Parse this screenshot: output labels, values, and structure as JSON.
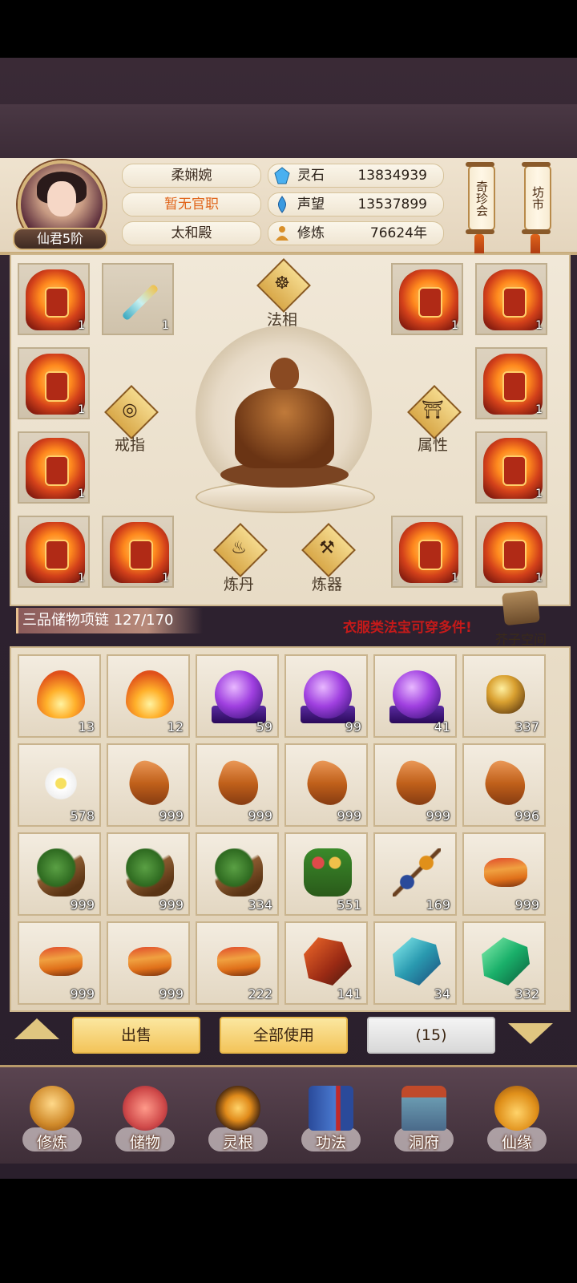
{
  "player": {
    "rank": "仙君5阶",
    "name": "柔娴婉",
    "office": "暂无官职",
    "palace": "太和殿"
  },
  "stats": [
    {
      "icon": "spirit-stone-icon",
      "label": "灵石",
      "value": "13834939"
    },
    {
      "icon": "prestige-icon",
      "label": "声望",
      "value": "13537899"
    },
    {
      "icon": "cultivation-icon",
      "label": "修炼",
      "value": "76624年"
    }
  ],
  "scrolls": {
    "treasure_fair": "奇珍会",
    "market": "坊市"
  },
  "equipment": {
    "slots": [
      {
        "item": "armor",
        "count": "1"
      },
      {
        "item": "sword",
        "count": "1"
      },
      {
        "item": "armor",
        "count": "1"
      },
      {
        "item": "armor",
        "count": "1"
      },
      {
        "item": "armor",
        "count": "1"
      },
      {
        "item": "armor",
        "count": "1"
      },
      {
        "item": "armor",
        "count": "1"
      },
      {
        "item": "armor",
        "count": "1"
      },
      {
        "item": "armor",
        "count": "1"
      },
      {
        "item": "armor",
        "count": "1"
      },
      {
        "item": "armor",
        "count": "1"
      },
      {
        "item": "armor",
        "count": "1"
      }
    ],
    "faxiang": "法相",
    "ring": "戒指",
    "attributes": "属性",
    "alchemy": "炼丹",
    "forging": "炼器"
  },
  "bag": {
    "title": "三品储物项链 127/170",
    "notice": "衣服类法宝可穿多件!",
    "space_label": "芥子空间",
    "items": [
      {
        "type": "flame",
        "count": "13"
      },
      {
        "type": "flame",
        "count": "12"
      },
      {
        "type": "orb",
        "count": "59"
      },
      {
        "type": "orb",
        "count": "99"
      },
      {
        "type": "orb",
        "count": "41"
      },
      {
        "type": "ore",
        "count": "337"
      },
      {
        "type": "flower",
        "count": "578"
      },
      {
        "type": "root",
        "count": "999"
      },
      {
        "type": "root",
        "count": "999"
      },
      {
        "type": "root",
        "count": "999"
      },
      {
        "type": "root",
        "count": "999"
      },
      {
        "type": "root",
        "count": "996"
      },
      {
        "type": "herb",
        "count": "999"
      },
      {
        "type": "herb",
        "count": "999"
      },
      {
        "type": "herb",
        "count": "334"
      },
      {
        "type": "sprig",
        "count": "551"
      },
      {
        "type": "branch",
        "count": "169"
      },
      {
        "type": "worm",
        "count": "999"
      },
      {
        "type": "worm",
        "count": "999"
      },
      {
        "type": "worm",
        "count": "999"
      },
      {
        "type": "worm",
        "count": "222"
      },
      {
        "type": "crystal-red",
        "count": "141"
      },
      {
        "type": "crystal-blue",
        "count": "34"
      },
      {
        "type": "crystal-green",
        "count": "332"
      }
    ]
  },
  "actions": {
    "sell": "出售",
    "use_all": "全部使用",
    "quantity": "(15)"
  },
  "nav": [
    {
      "label": "修炼",
      "icon": "cultivate-icon"
    },
    {
      "label": "储物",
      "icon": "storage-bag-icon"
    },
    {
      "label": "灵根",
      "icon": "spirit-root-icon"
    },
    {
      "label": "功法",
      "icon": "technique-book-icon"
    },
    {
      "label": "洞府",
      "icon": "cave-dwelling-icon"
    },
    {
      "label": "仙缘",
      "icon": "destiny-gourd-icon"
    }
  ],
  "colors": {
    "accent_orange": "#e0641a",
    "notice_red": "#c41a1a",
    "button_gold": "#f3c45a"
  }
}
